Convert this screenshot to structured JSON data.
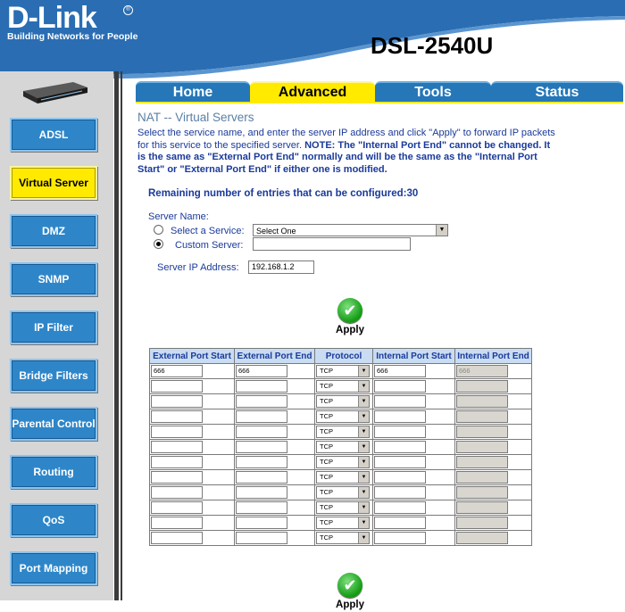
{
  "header": {
    "brand": "D-Link",
    "tm": "®",
    "tagline": "Building Networks for People",
    "model": "DSL-2540U"
  },
  "tabs": [
    {
      "label": "Home"
    },
    {
      "label": "Advanced",
      "active": true
    },
    {
      "label": "Tools"
    },
    {
      "label": "Status"
    }
  ],
  "sidebar": {
    "items": [
      {
        "label": "ADSL"
      },
      {
        "label": "Virtual Server",
        "active": true
      },
      {
        "label": "DMZ"
      },
      {
        "label": "SNMP"
      },
      {
        "label": "IP Filter"
      },
      {
        "label": "Bridge Filters"
      },
      {
        "label": "Parental Control"
      },
      {
        "label": "Routing"
      },
      {
        "label": "QoS"
      },
      {
        "label": "Port Mapping"
      }
    ]
  },
  "content": {
    "title": "NAT -- Virtual Servers",
    "desc_plain": "Select the service name, and enter the server IP address and click \"Apply\" to forward IP packets for this service to the specified server.",
    "desc_bold": "NOTE: The \"Internal Port End\" cannot be changed. It is the same as \"External Port End\" normally and will be the same as the \"Internal Port Start\" or \"External Port End\" if either one is modified.",
    "remaining": "Remaining number of entries that can be configured:30",
    "server_name_label": "Server Name:",
    "select_service_label": "Select a Service:",
    "select_service_value": "Select One",
    "custom_server_label": "Custom Server:",
    "custom_server_value": "",
    "server_ip_label": "Server IP Address:",
    "server_ip_value": "192.168.1.2",
    "apply_label": "Apply",
    "apply_label_bottom": "Apply"
  },
  "table": {
    "headers": [
      "External Port Start",
      "External Port End",
      "Protocol",
      "Internal Port Start",
      "Internal Port End"
    ],
    "rows": [
      {
        "ext_start": "666",
        "ext_end": "666",
        "protocol": "TCP",
        "int_start": "666",
        "int_end": "666"
      },
      {
        "ext_start": "",
        "ext_end": "",
        "protocol": "TCP",
        "int_start": "",
        "int_end": ""
      },
      {
        "ext_start": "",
        "ext_end": "",
        "protocol": "TCP",
        "int_start": "",
        "int_end": ""
      },
      {
        "ext_start": "",
        "ext_end": "",
        "protocol": "TCP",
        "int_start": "",
        "int_end": ""
      },
      {
        "ext_start": "",
        "ext_end": "",
        "protocol": "TCP",
        "int_start": "",
        "int_end": ""
      },
      {
        "ext_start": "",
        "ext_end": "",
        "protocol": "TCP",
        "int_start": "",
        "int_end": ""
      },
      {
        "ext_start": "",
        "ext_end": "",
        "protocol": "TCP",
        "int_start": "",
        "int_end": ""
      },
      {
        "ext_start": "",
        "ext_end": "",
        "protocol": "TCP",
        "int_start": "",
        "int_end": ""
      },
      {
        "ext_start": "",
        "ext_end": "",
        "protocol": "TCP",
        "int_start": "",
        "int_end": ""
      },
      {
        "ext_start": "",
        "ext_end": "",
        "protocol": "TCP",
        "int_start": "",
        "int_end": ""
      },
      {
        "ext_start": "",
        "ext_end": "",
        "protocol": "TCP",
        "int_start": "",
        "int_end": ""
      },
      {
        "ext_start": "",
        "ext_end": "",
        "protocol": "TCP",
        "int_start": "",
        "int_end": ""
      }
    ]
  },
  "colors": {
    "brand_blue": "#2a6db3",
    "accent_yellow": "#ffea00",
    "text_blue": "#1a3a9a"
  }
}
